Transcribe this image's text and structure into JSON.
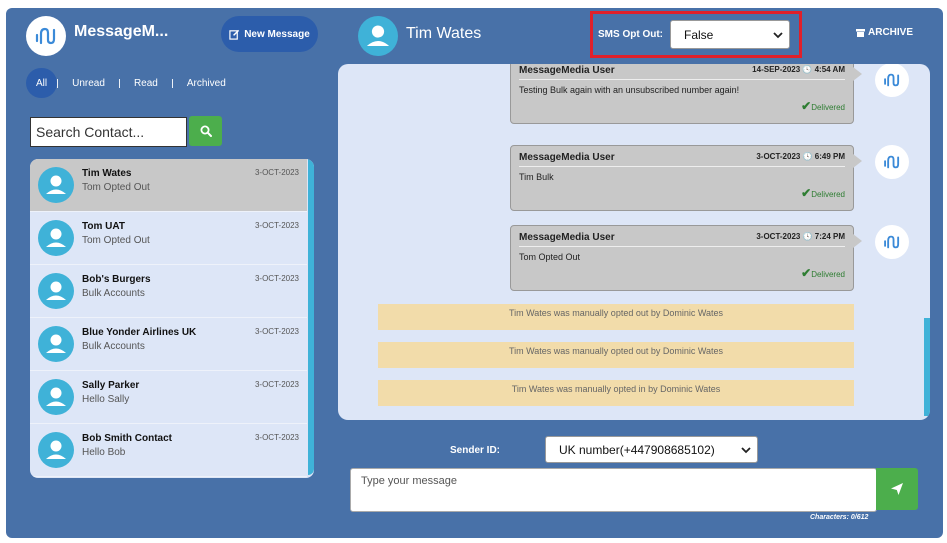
{
  "brand": {
    "name": "MessageM...",
    "new_message_label": "New Message"
  },
  "filters": [
    "All",
    "Unread",
    "Read",
    "Archived"
  ],
  "search": {
    "placeholder": "Search Contact..."
  },
  "contacts": [
    {
      "name": "Tim Wates",
      "preview": "Tom Opted Out",
      "date": "3-OCT-2023",
      "selected": true
    },
    {
      "name": "Tom UAT",
      "preview": "Tom Opted Out",
      "date": "3-OCT-2023"
    },
    {
      "name": "Bob's Burgers",
      "preview": "Bulk Accounts",
      "date": "3-OCT-2023"
    },
    {
      "name": "Blue Yonder Airlines UK",
      "preview": "Bulk Accounts",
      "date": "3-OCT-2023"
    },
    {
      "name": "Sally Parker",
      "preview": "Hello Sally",
      "date": "3-OCT-2023"
    },
    {
      "name": "Bob Smith Contact",
      "preview": "Hello Bob",
      "date": "3-OCT-2023"
    }
  ],
  "chat": {
    "name": "Tim Wates",
    "sms_opt_out_label": "SMS Opt Out:",
    "sms_opt_out_value": "False",
    "archive_label": "ARCHIVE"
  },
  "messages": [
    {
      "sender": "MessageMedia User",
      "datetime": "14-SEP-2023 🕓 4:54 AM",
      "text": "Testing Bulk again with an unsubscribed number again!",
      "status": "Delivered"
    },
    {
      "sender": "MessageMedia User",
      "datetime": "3-OCT-2023 🕓 6:49 PM",
      "text": "Tim Bulk",
      "status": "Delivered"
    },
    {
      "sender": "MessageMedia User",
      "datetime": "3-OCT-2023 🕓 7:24 PM",
      "text": "Tom Opted Out",
      "status": "Delivered"
    }
  ],
  "notices": [
    "Tim Wates was manually opted out by Dominic Wates",
    "Tim Wates was manually opted out by Dominic Wates",
    "Tim Wates was manually opted in by Dominic Wates"
  ],
  "compose": {
    "sender_id_label": "Sender ID:",
    "sender_id_value": "UK number(+447908685102)",
    "placeholder": "Type your message",
    "characters": "Characters: 0/612"
  },
  "colors": {
    "background": "#4871a8",
    "accent": "#2c5dab",
    "success": "#4cae4c",
    "highlight": "#e0202a"
  },
  "icons": [
    "brand-logo-icon",
    "edit-icon",
    "search-icon",
    "user-avatar-icon",
    "chevron-down-icon",
    "archive-icon",
    "check-icon",
    "send-icon"
  ]
}
